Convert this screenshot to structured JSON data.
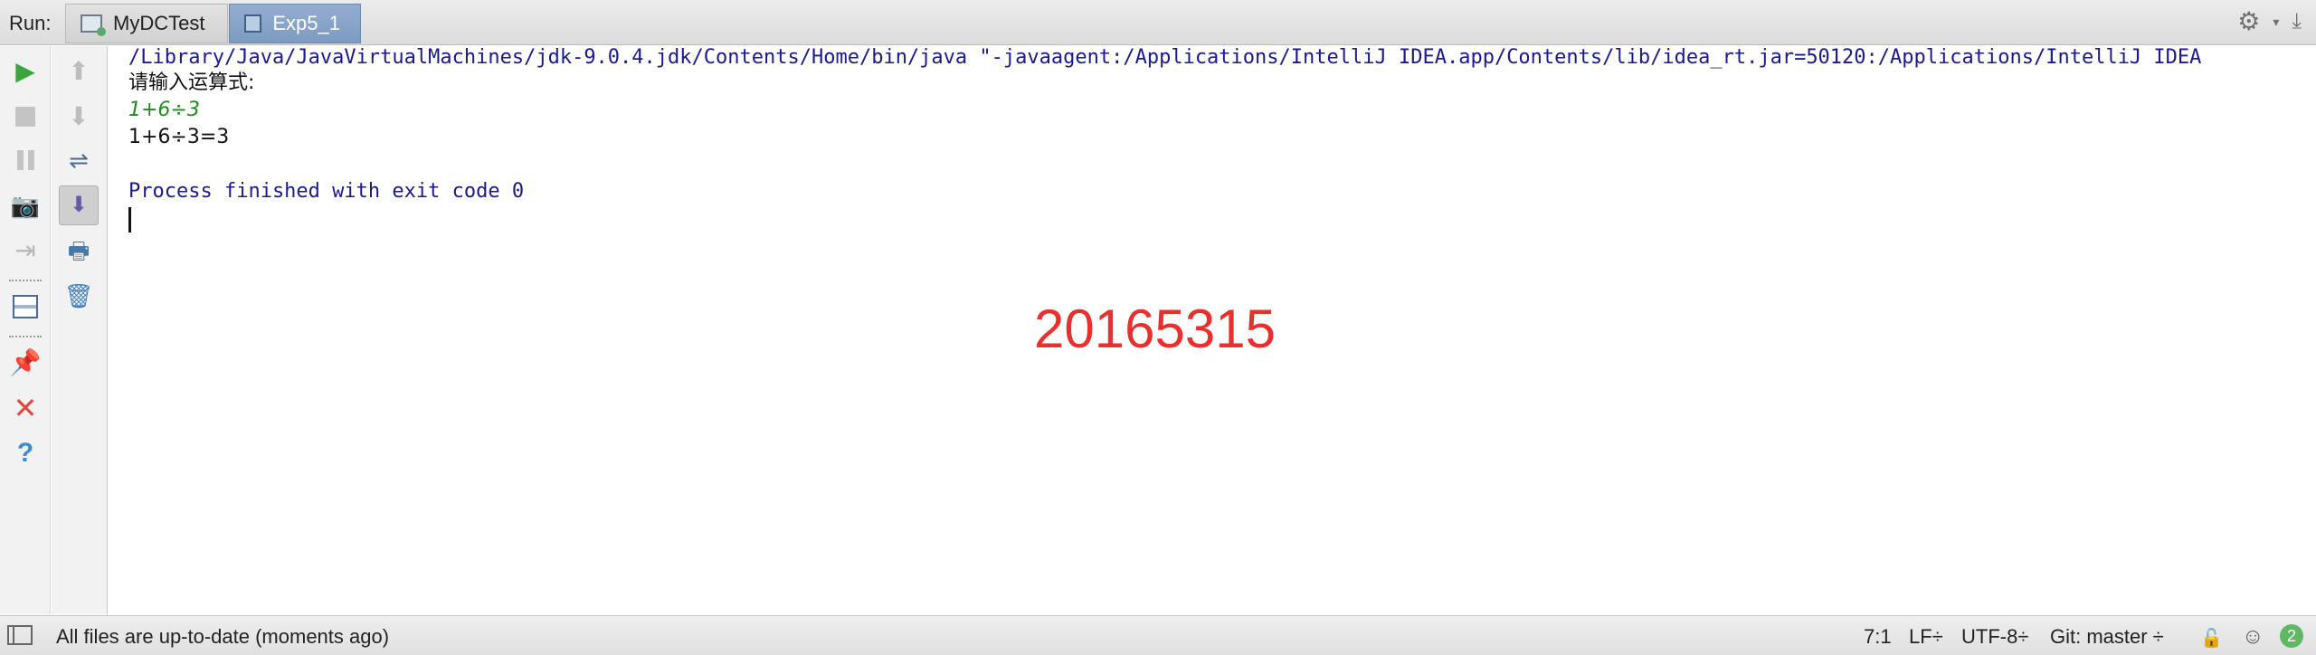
{
  "run_panel": {
    "label": "Run:",
    "tabs": [
      {
        "label": "MyDCTest",
        "active": false
      },
      {
        "label": "Exp5_1",
        "active": true
      }
    ]
  },
  "console": {
    "command_line": "/Library/Java/JavaVirtualMachines/jdk-9.0.4.jdk/Contents/Home/bin/java \"-javaagent:/Applications/IntelliJ IDEA.app/Contents/lib/idea_rt.jar=50120:/Applications/IntelliJ IDEA",
    "prompt": "请输入运算式:",
    "user_input": "1+6÷3",
    "result": "1+6÷3=3",
    "exit_message": "Process finished with exit code 0",
    "watermark": "20165315"
  },
  "status_bar": {
    "message": "All files are up-to-date (moments ago)",
    "position": "7:1",
    "line_separator": "LF÷",
    "encoding": "UTF-8÷",
    "vcs": "Git: master ÷",
    "notifications_count": "2"
  },
  "colors": {
    "console_system": "#1a1a8c",
    "console_input": "#1f8a1f",
    "watermark": "#e8312f",
    "active_tab": "#7d9ac0"
  }
}
